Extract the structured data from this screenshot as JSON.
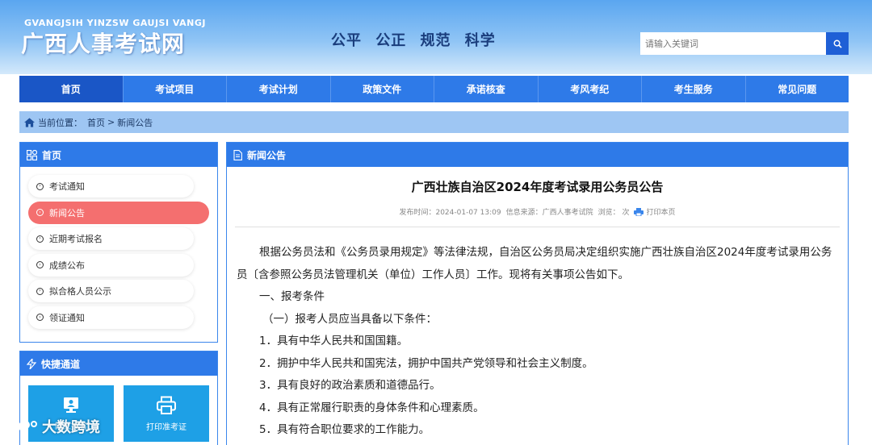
{
  "header": {
    "logo_sub": "GVANGJSIH YINZSW GAUJSI VANGJ",
    "logo_main": "广西人事考试网",
    "slogan": "公平 公正 规范 科学",
    "search_placeholder": "请输入关键词"
  },
  "nav": {
    "items": [
      "首页",
      "考试项目",
      "考试计划",
      "政策文件",
      "承诺核查",
      "考风考纪",
      "考生服务",
      "常见问题"
    ]
  },
  "breadcrumb": {
    "prefix": "当前位置：",
    "home": "首页",
    "separator": ">",
    "current": "新闻公告"
  },
  "sidebar": {
    "home_title": "首页",
    "menu": [
      "考试通知",
      "新闻公告",
      "近期考试报名",
      "成绩公布",
      "拟合格人员公示",
      "领证通知"
    ],
    "quick_title": "快捷通道",
    "quick": [
      "网上报名",
      "打印准考证"
    ]
  },
  "content": {
    "section_title": "新闻公告",
    "article_title": "广西壮族自治区2024年度考试录用公务员公告",
    "meta_date": "发布时间：2024-01-07 13:09",
    "meta_source": "信息来源：广西人事考试院",
    "meta_views": "浏览：  次",
    "print_label": "打印本页",
    "paragraphs": [
      "根据公务员法和《公务员录用规定》等法律法规，自治区公务员局决定组织实施广西壮族自治区2024年度考试录用公务员〔含参照公务员法管理机关（单位）工作人员〕工作。现将有关事项公告如下。",
      "一、报考条件",
      "（一）报考人员应当具备以下条件：",
      "1．具有中华人民共和国国籍。",
      "2．拥护中华人民共和国宪法，拥护中国共产党领导和社会主义制度。",
      "3．具有良好的政治素质和道德品行。",
      "4．具有正常履行职责的身体条件和心理素质。",
      "5．具有符合职位要求的工作能力。"
    ]
  },
  "watermark": "大数跨境",
  "colors": {
    "nav_bg": "#2e7ae8",
    "nav_active": "#1a56c6",
    "menu_active": "#f46f6f",
    "quick_bg": "#1ea0e6"
  }
}
